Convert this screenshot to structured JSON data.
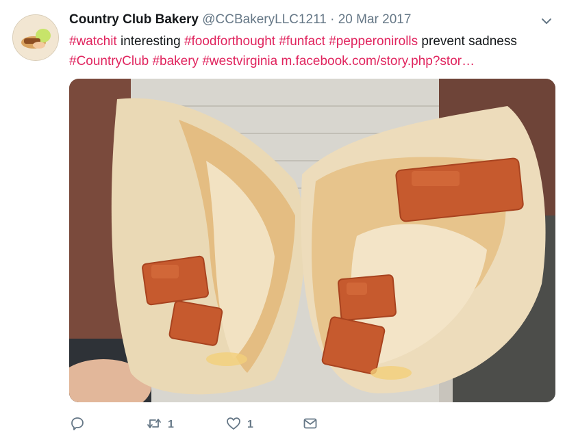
{
  "tweet": {
    "author_name": "Country Club Bakery",
    "author_handle": "@CCBakeryLLC1211",
    "separator": "·",
    "date": "20 Mar 2017",
    "text_parts": [
      {
        "type": "hashtag",
        "text": "#watchit"
      },
      {
        "type": "plain",
        "text": " interesting "
      },
      {
        "type": "hashtag",
        "text": "#foodforthought"
      },
      {
        "type": "plain",
        "text": " "
      },
      {
        "type": "hashtag",
        "text": "#funfact"
      },
      {
        "type": "plain",
        "text": " "
      },
      {
        "type": "hashtag",
        "text": "#pepperonirolls"
      },
      {
        "type": "plain",
        "text": " prevent sadness "
      },
      {
        "type": "hashtag",
        "text": "#CountryClub"
      },
      {
        "type": "plain",
        "text": " "
      },
      {
        "type": "hashtag",
        "text": "#bakery"
      },
      {
        "type": "plain",
        "text": " "
      },
      {
        "type": "hashtag",
        "text": "#westvirginia"
      },
      {
        "type": "plain",
        "text": " "
      },
      {
        "type": "link",
        "text": "m.facebook.com/story.php?stor…"
      }
    ],
    "actions": {
      "reply": {
        "icon": "reply-icon",
        "count": ""
      },
      "retweet": {
        "icon": "retweet-icon",
        "count": "1"
      },
      "like": {
        "icon": "heart-icon",
        "count": "1"
      },
      "message": {
        "icon": "envelope-icon",
        "count": ""
      }
    }
  },
  "colors": {
    "accent": "#e0245e",
    "muted": "#657786",
    "text": "#14171a"
  }
}
